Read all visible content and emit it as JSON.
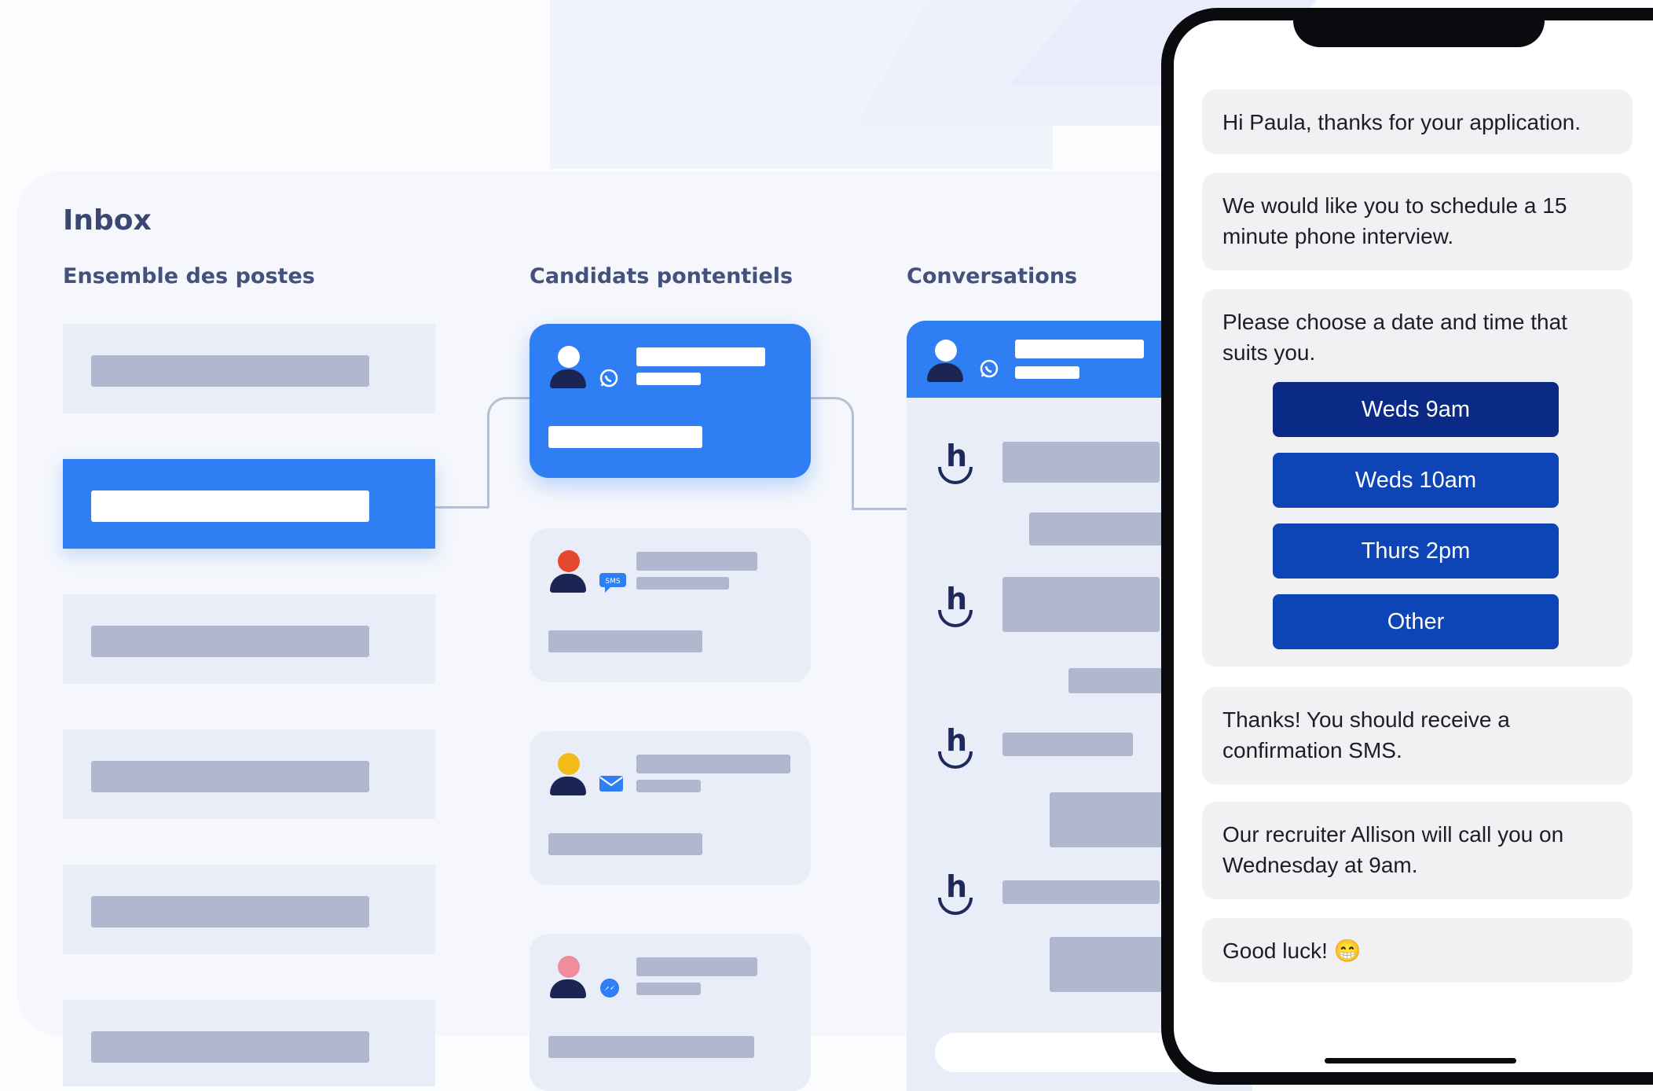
{
  "inbox": {
    "title": "Inbox",
    "columns": {
      "jobs": "Ensemble des postes",
      "candidates": "Candidats pontentiels",
      "conversations": "Conversations"
    }
  },
  "candidates": [
    {
      "channel_icon": "whatsapp-icon",
      "avatar_color": "#ffffff",
      "active": true
    },
    {
      "channel_icon": "sms-icon",
      "avatar_color": "#e5482a",
      "active": false
    },
    {
      "channel_icon": "mail-icon",
      "avatar_color": "#f2bd1a",
      "active": false
    },
    {
      "channel_icon": "messenger-icon",
      "avatar_color": "#f08d9a",
      "active": false
    }
  ],
  "colors": {
    "accent": "#2f7ef3",
    "button_selected": "#0b2a86",
    "button": "#0d44b6"
  },
  "chat": {
    "messages": [
      "Hi Paula, thanks for your application.",
      "We would like you to schedule a 15 minute phone interview.",
      "Please choose a date and time that suits you.",
      "Thanks! You should receive a confirmation SMS.",
      "Our recruiter Allison will call you on Wednesday at 9am.",
      "Good luck! 😁"
    ],
    "options": [
      "Weds 9am",
      "Weds 10am",
      "Thurs 2pm",
      "Other"
    ],
    "selected_option": "Weds 9am"
  }
}
